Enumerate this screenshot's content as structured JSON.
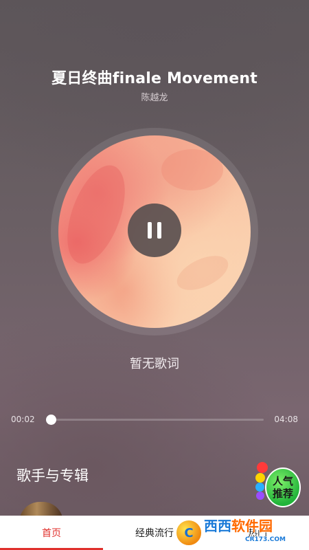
{
  "now_playing": {
    "title": "夏日终曲finale Movement",
    "artist": "陈越龙",
    "lyrics": "暂无歌词",
    "elapsed": "00:02",
    "duration": "04:08",
    "progress_fraction": 0.008
  },
  "section": {
    "title": "歌手与专辑"
  },
  "badge": {
    "line1": "人气",
    "line2": "推荐"
  },
  "tabs": [
    {
      "label": "首页",
      "active": true
    },
    {
      "label": "经典流行",
      "active": false
    },
    {
      "label": "热门",
      "active": false
    }
  ],
  "watermark": {
    "text_left": "西西",
    "text_right": "软件园",
    "url": "CR173.COM"
  },
  "colors": {
    "accent": "#e0302c",
    "background": "#6f6068"
  },
  "icons": {
    "play_state": "pause-icon"
  }
}
